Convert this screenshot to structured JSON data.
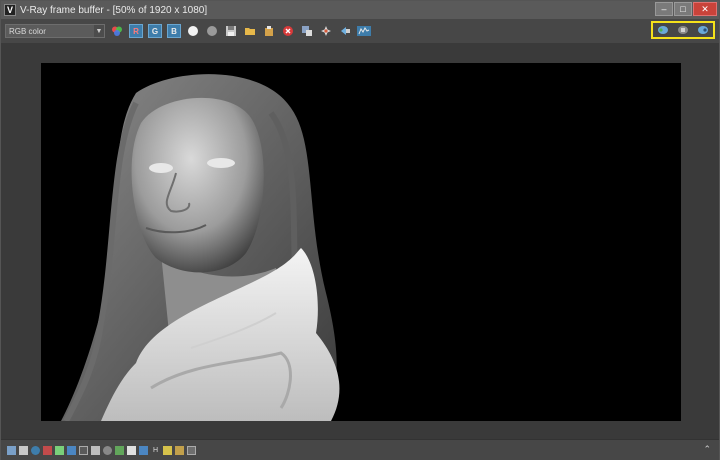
{
  "window": {
    "title": "V-Ray frame buffer - [50% of 1920 x 1080]",
    "app_icon_letter": "V",
    "controls": {
      "minimize": "–",
      "maximize": "□",
      "close": "✕"
    }
  },
  "toolbar": {
    "channel_select_value": "RGB color",
    "channel_buttons": {
      "red": "R",
      "green": "G",
      "blue": "B"
    },
    "highlighted_group_color": "#f5e11b"
  },
  "statusbar": {
    "hdr_label": "H",
    "expand_icon": "⌃"
  },
  "colors": {
    "window_bg": "#3a3a3a",
    "toolbar_bg": "#474747",
    "accent_blue": "#3e7dab",
    "close_red": "#c9433a"
  }
}
